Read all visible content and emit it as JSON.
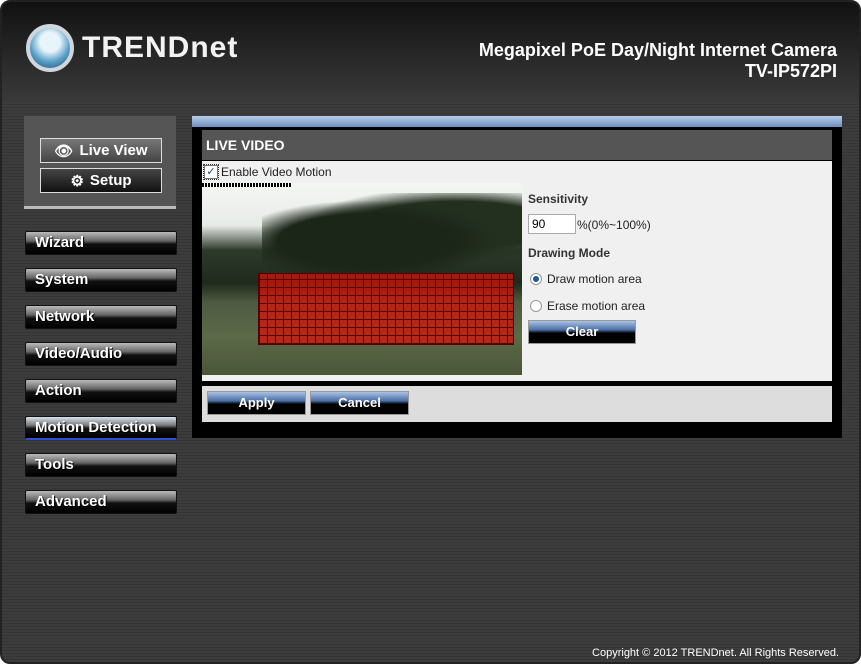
{
  "header": {
    "brand": "TRENDnet",
    "product_title": "Megapixel PoE Day/Night Internet Camera",
    "model": "TV-IP572PI"
  },
  "top_buttons": {
    "live_view": "Live View",
    "setup": "Setup"
  },
  "nav": [
    {
      "label": "Wizard"
    },
    {
      "label": "System"
    },
    {
      "label": "Network"
    },
    {
      "label": "Video/Audio"
    },
    {
      "label": "Action"
    },
    {
      "label": "Motion Detection",
      "active": true
    },
    {
      "label": "Tools"
    },
    {
      "label": "Advanced"
    }
  ],
  "main": {
    "title": "LIVE VIDEO",
    "enable_label": "Enable Video Motion",
    "enable_checked": true,
    "sensitivity_label": "Sensitivity",
    "sensitivity_value": "90",
    "sensitivity_range": "%(0%~100%)",
    "drawing_mode_label": "Drawing Mode",
    "modes": [
      {
        "label": "Draw motion area",
        "selected": true
      },
      {
        "label": "Erase motion area",
        "selected": false
      }
    ],
    "clear": "Clear",
    "apply": "Apply",
    "cancel": "Cancel"
  },
  "footer": {
    "copyright": "Copyright © 2012 TRENDnet. All Rights Reserved."
  },
  "colors": {
    "accent": "#4c6fa5",
    "motion_area": "#d2140a"
  }
}
